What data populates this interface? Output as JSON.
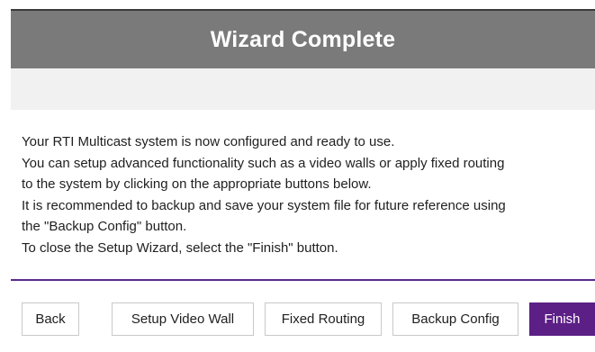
{
  "dialog": {
    "title": "Wizard Complete"
  },
  "message": {
    "lines": [
      "Your RTI Multicast system is now configured and ready to use.",
      "You can setup advanced functionality such as a video walls or apply fixed routing",
      "to the system by clicking on the appropriate buttons below.",
      "It is recommended to backup and save your system file for future reference using",
      "the \"Backup Config\" button.",
      "To close the Setup Wizard, select the \"Finish\" button."
    ]
  },
  "buttons": {
    "back": "Back",
    "setup_video_wall": "Setup Video Wall",
    "fixed_routing": "Fixed Routing",
    "backup_config": "Backup Config",
    "finish": "Finish"
  },
  "colors": {
    "header_bg": "#7a7a7a",
    "accent": "#5c1f86"
  }
}
